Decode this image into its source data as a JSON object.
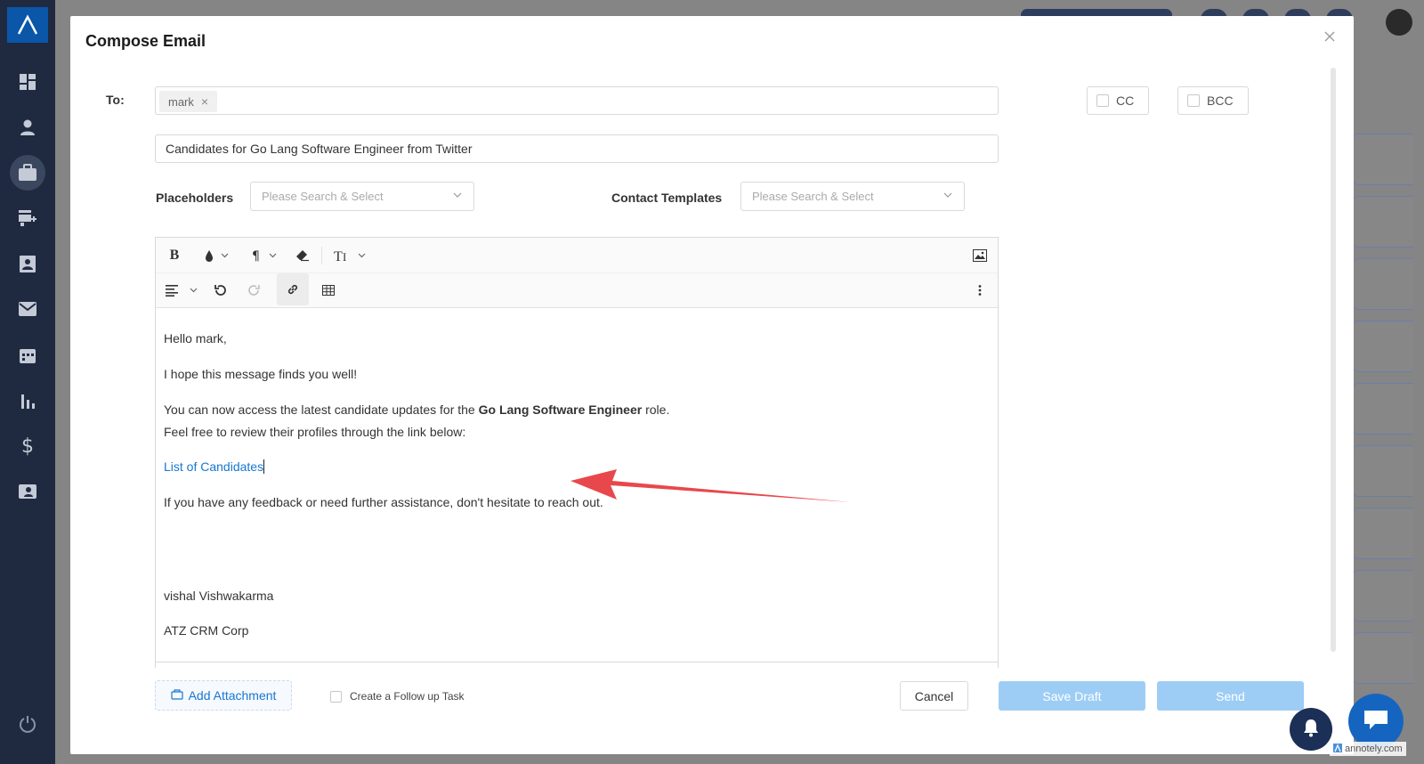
{
  "modal": {
    "title": "Compose Email"
  },
  "to": {
    "label": "To:",
    "recipients": [
      "mark"
    ]
  },
  "cc": {
    "label": "CC"
  },
  "bcc": {
    "label": "BCC"
  },
  "subject": "Candidates for Go Lang Software Engineer from Twitter",
  "placeholders": {
    "label": "Placeholders",
    "placeholder": "Please Search & Select"
  },
  "contact_templates": {
    "label": "Contact Templates",
    "placeholder": "Please Search & Select"
  },
  "body": {
    "greeting": "Hello mark,",
    "line1": "I hope this message finds you well!",
    "line2_prefix": "You can now access the latest candidate updates for the ",
    "line2_bold": "Go Lang Software Engineer",
    "line2_suffix": " role.",
    "line3": "Feel free to review their profiles through the link below:",
    "link": "List of Candidates",
    "line4": "If you have any feedback or need further assistance, don't hesitate to reach out.",
    "signature_name": "vishal Vishwakarma",
    "signature_company": "ATZ CRM Corp"
  },
  "footer": {
    "add_attachment": "Add Attachment",
    "follow_up": "Create a Follow up Task",
    "cancel": "Cancel",
    "save_draft": "Save Draft",
    "send": "Send"
  },
  "watermark": "annotely.com",
  "colors": {
    "sidebar": "#1f2a40",
    "link": "#1677d2",
    "primary_disabled": "#9dcdf5",
    "annotation_arrow": "#e8484b"
  },
  "icons": {
    "sidebar": [
      "dashboard-icon",
      "person-icon",
      "briefcase-icon",
      "store-add-icon",
      "contact-card-icon",
      "mail-icon",
      "calendar-icon",
      "bar-chart-icon",
      "dollar-icon",
      "id-card-icon",
      "power-icon"
    ],
    "toolbar": [
      "bold-icon",
      "ink-drop-icon",
      "paragraph-icon",
      "eraser-icon",
      "text-size-icon",
      "image-icon",
      "align-icon",
      "undo-icon",
      "redo-icon",
      "link-icon",
      "table-icon",
      "more-icon"
    ]
  }
}
